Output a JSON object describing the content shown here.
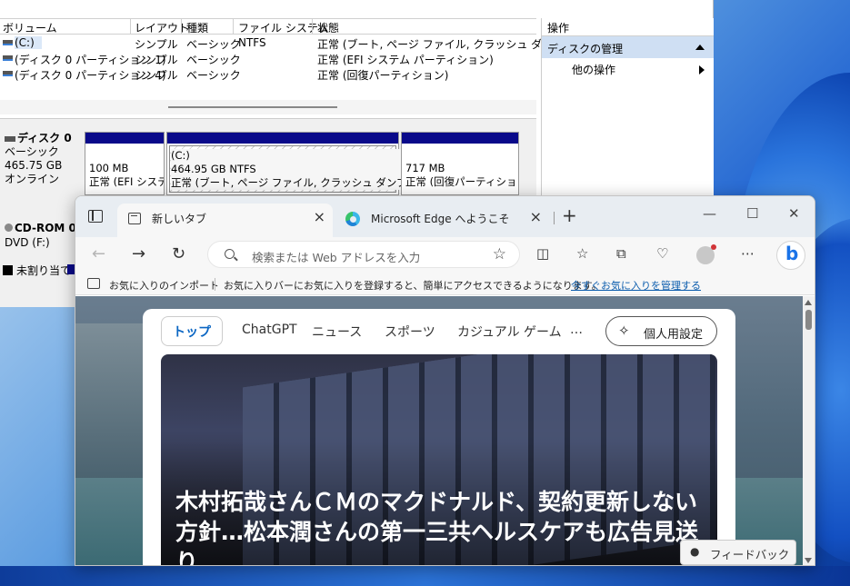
{
  "disk_mgmt": {
    "columns": [
      "ボリューム",
      "レイアウト",
      "種類",
      "ファイル システム",
      "状態"
    ],
    "volumes": [
      {
        "name": "(C:)",
        "layout": "シンプル",
        "type": "ベーシック",
        "fs": "NTFS",
        "status": "正常 (ブート, ページ ファイル, クラッシュ ダンプ, ベーシ"
      },
      {
        "name": "(ディスク 0 パーティション 1)",
        "layout": "シンプル",
        "type": "ベーシック",
        "fs": "",
        "status": "正常 (EFI システム パーティション)"
      },
      {
        "name": "(ディスク 0 パーティション 4)",
        "layout": "シンプル",
        "type": "ベーシック",
        "fs": "",
        "status": "正常 (回復パーティション)"
      }
    ],
    "disk0": {
      "name": "ディスク 0",
      "type": "ベーシック",
      "size": "465.75 GB",
      "state": "オンライン"
    },
    "partitions": [
      {
        "line1": "",
        "line2": "100 MB",
        "line3": "正常 (EFI システ"
      },
      {
        "line1": "(C:)",
        "line2": "464.95 GB NTFS",
        "line3": "正常 (ブート, ページ ファイル, クラッシュ ダンプ, ベーシ"
      },
      {
        "line1": "",
        "line2": "717 MB",
        "line3": "正常 (回復パーティション"
      }
    ],
    "cdrom": {
      "name": "CD-ROM 0",
      "drive": "DVD (F:)"
    },
    "legend_unallocated": "未割り当て",
    "ops": {
      "title": "操作",
      "section": "ディスクの管理",
      "item": "他の操作"
    }
  },
  "edge": {
    "tabs": [
      {
        "label": "新しいタブ",
        "active": true
      },
      {
        "label": "Microsoft Edge へようこそ",
        "active": false
      }
    ],
    "new_tab": "+",
    "window_controls": {
      "minimize": "—",
      "maximize": "☐",
      "close": "✕"
    },
    "nav": {
      "back": "←",
      "forward": "→",
      "refresh": "↻"
    },
    "address_placeholder": "検索または Web アドレスを入力",
    "toolbar_icons": [
      "split-screen-icon",
      "favorites-icon",
      "collections-icon",
      "browser-essentials-icon",
      "profile-icon",
      "more-icon",
      "copilot-icon"
    ],
    "favbar": {
      "import": "お気に入りのインポート",
      "hint": "お気に入りバーにお気に入りを登録すると、簡単にアクセスできるようになります。",
      "manage_link": "今すぐお気に入りを管理する"
    },
    "feed_tabs": [
      "トップ",
      "ChatGPT",
      "ニュース",
      "スポーツ",
      "カジュアル ゲーム",
      "…"
    ],
    "personalize": "個人用設定",
    "headline": "木村拓哉さんＣＭのマクドナルド、契約更新しない方針…松本潤さんの第一三共ヘルスケアも広告見送り",
    "feedback": "フィードバック"
  }
}
